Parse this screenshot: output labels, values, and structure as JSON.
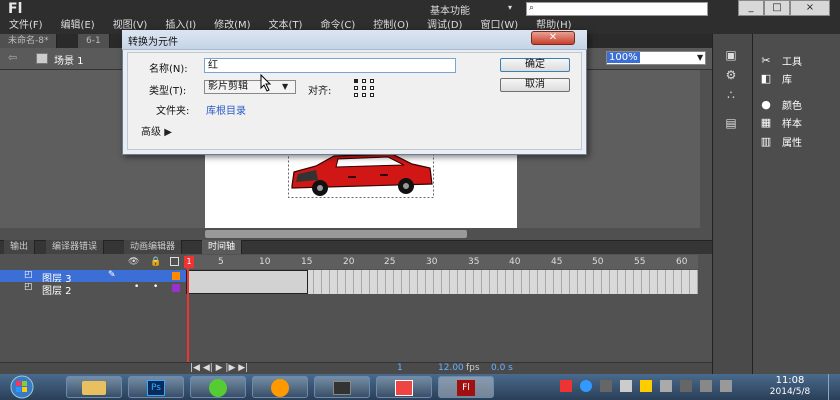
{
  "app": {
    "logo": "Fl",
    "workspace": "基本功能",
    "search_placeholder": ""
  },
  "window_controls": {
    "minimize": "_",
    "restore": "□",
    "close": "×"
  },
  "menu": [
    "文件(F)",
    "编辑(E)",
    "视图(V)",
    "插入(I)",
    "修改(M)",
    "文本(T)",
    "命令(C)",
    "控制(O)",
    "调试(D)",
    "窗口(W)",
    "帮助(H)"
  ],
  "doc_tabs": [
    "未命名-8*",
    "6-1"
  ],
  "scene": {
    "label": "场景 1",
    "zoom": "100%"
  },
  "dialog": {
    "title": "转换为元件",
    "name_label": "名称(N):",
    "name_value": "红",
    "type_label": "类型(T):",
    "type_value": "影片剪辑",
    "align_label": "对齐:",
    "folder_label": "文件夹:",
    "folder_value": "库根目录",
    "advanced_label": "高级",
    "ok_label": "确定",
    "cancel_label": "取消"
  },
  "right_panel": {
    "items": [
      {
        "label": "工具",
        "icon": "tools-icon"
      },
      {
        "label": "库",
        "icon": "library-icon"
      },
      {
        "label": "颜色",
        "icon": "color-icon"
      },
      {
        "label": "样本",
        "icon": "swatches-icon"
      },
      {
        "label": "属性",
        "icon": "properties-icon"
      }
    ]
  },
  "panel_tabs": [
    "输出",
    "编译器错误",
    "动画编辑器",
    "时间轴"
  ],
  "timeline": {
    "ruler": [
      "1",
      "5",
      "10",
      "15",
      "20",
      "25",
      "30",
      "35",
      "40",
      "45",
      "50",
      "55",
      "60"
    ],
    "layers": [
      {
        "name": "图层 3",
        "selected": true,
        "color": "#ff8a00"
      },
      {
        "name": "图层 2",
        "selected": false,
        "color": "#9b30d0"
      }
    ],
    "current_frame": "1",
    "fps": "12.00",
    "fps_unit": "fps",
    "time": "0.0 s"
  },
  "taskbar": {
    "time": "11:08",
    "date": "2014/5/8"
  }
}
